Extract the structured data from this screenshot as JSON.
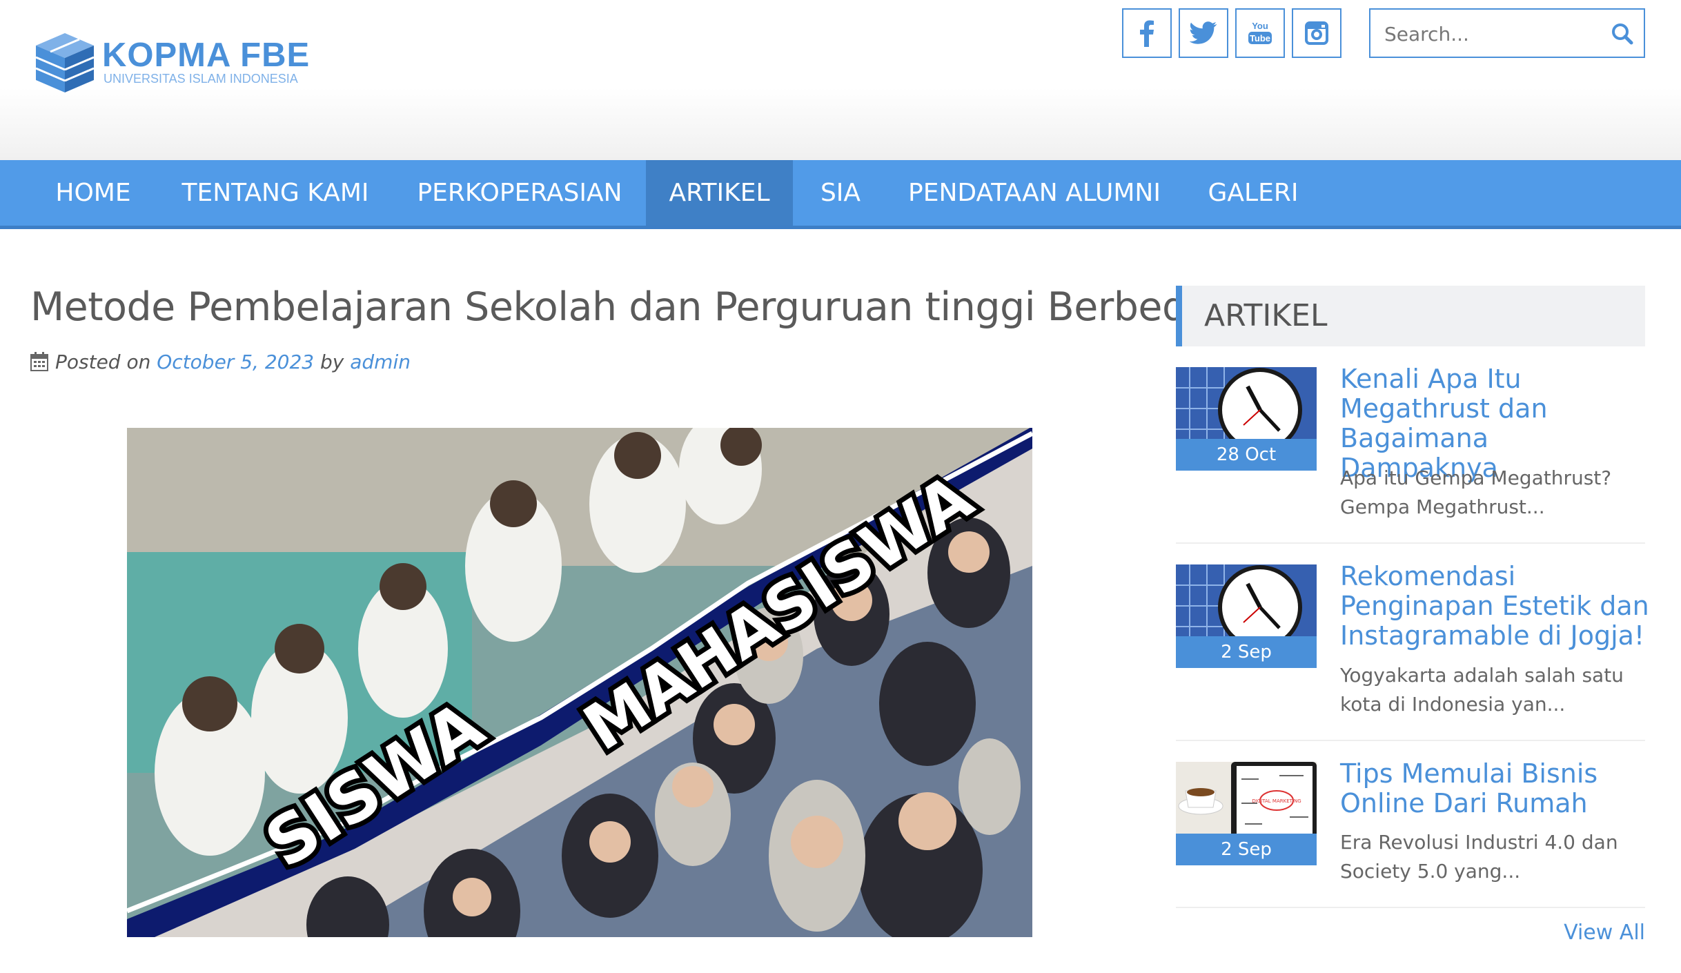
{
  "header": {
    "logo_title": "KOPMA FBE",
    "logo_subtitle": "UNIVERSITAS ISLAM INDONESIA",
    "social": [
      "facebook-icon",
      "twitter-icon",
      "youtube-icon",
      "instagram-icon"
    ],
    "youtube_text": [
      "You",
      "Tube"
    ],
    "search_placeholder": "Search..."
  },
  "nav": {
    "items": [
      "HOME",
      "TENTANG KAMI",
      "PERKOPERASIAN",
      "ARTIKEL",
      "SIA",
      "PENDATAAN ALUMNI",
      "GALERI"
    ],
    "active": "ARTIKEL"
  },
  "post": {
    "title": "Metode Pembelajaran Sekolah dan Perguruan tinggi Berbeda",
    "posted_on": "Posted on",
    "date": "October 5, 2023",
    "by": "by",
    "author": "admin",
    "image_text_left": "SISWA",
    "image_text_right": "MAHASISWA"
  },
  "sidebar": {
    "heading": "ARTIKEL",
    "entries": [
      {
        "title": "Kenali Apa Itu Megathrust dan Bagaimana Dampaknya",
        "date": "28 Oct",
        "excerpt": "Apa itu Gempa Megathrust? Gempa Megathrust..."
      },
      {
        "title": "Rekomendasi Penginapan Estetik dan Instagramable di Jogja!",
        "date": "2 Sep",
        "excerpt": "Yogyakarta adalah salah satu kota di Indonesia yan..."
      },
      {
        "title": "Tips Memulai Bisnis Online Dari Rumah",
        "date": "2 Sep",
        "excerpt": "Era Revolusi Industri 4.0 dan Society 5.0 yang..."
      }
    ],
    "thumb3_text": "DIGITAL MARKETING",
    "view_all": "View All"
  },
  "colors": {
    "accent": "#4a90d9",
    "nav": "#519be8",
    "nav_active": "#3f80c6",
    "navy": "#0d1b6e"
  }
}
